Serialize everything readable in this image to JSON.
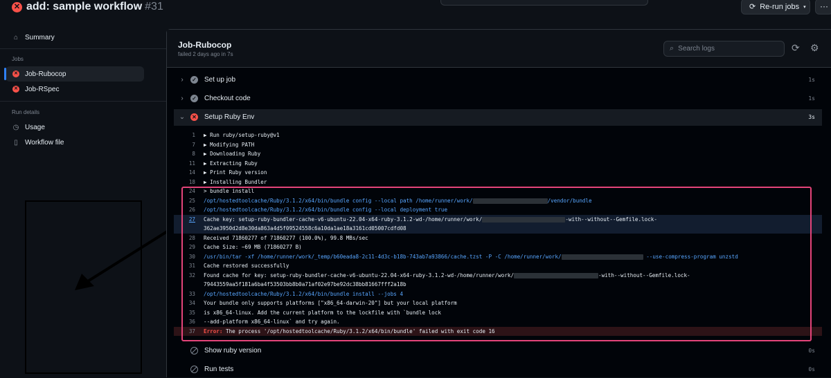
{
  "header": {
    "run_title": "add: sample workflow",
    "run_number": "#31",
    "rerun_label": "Re-run jobs",
    "more_label": "···"
  },
  "sidebar": {
    "summary_label": "Summary",
    "jobs_heading": "Jobs",
    "jobs": [
      {
        "label": "Job-Rubocop",
        "status": "failed",
        "active": true
      },
      {
        "label": "Job-RSpec",
        "status": "failed",
        "active": false
      }
    ],
    "run_details_heading": "Run details",
    "details": [
      {
        "label": "Usage",
        "icon": "stopwatch-icon"
      },
      {
        "label": "Workflow file",
        "icon": "file-icon"
      }
    ]
  },
  "job": {
    "title": "Job-Rubocop",
    "subtitle": "failed 2 days ago in 7s",
    "search_placeholder": "Search logs"
  },
  "steps_before": [
    {
      "name": "Set up job",
      "time": "1s",
      "status": "success"
    },
    {
      "name": "Checkout code",
      "time": "1s",
      "status": "success"
    }
  ],
  "open_step": {
    "name": "Setup Ruby Env",
    "time": "3s",
    "status": "failed"
  },
  "log_lines": [
    {
      "n": "1",
      "text": "▶ Run ruby/setup-ruby@v1",
      "kind": "normal"
    },
    {
      "n": "7",
      "text": "▶ Modifying PATH",
      "kind": "normal"
    },
    {
      "n": "8",
      "text": "▶ Downloading Ruby",
      "kind": "normal"
    },
    {
      "n": "11",
      "text": "▶ Extracting  Ruby",
      "kind": "normal"
    },
    {
      "n": "14",
      "text": "▶ Print Ruby version",
      "kind": "normal"
    },
    {
      "n": "18",
      "text": "▶ Installing Bundler",
      "kind": "normal"
    },
    {
      "n": "24",
      "text": "> bundle install",
      "kind": "normal"
    },
    {
      "n": "25",
      "text": "/opt/hostedtoolcache/Ruby/3.1.2/x64/bin/bundle config --local path /home/runner/work/",
      "after": "/vendor/bundle",
      "redact": 108,
      "kind": "cmd"
    },
    {
      "n": "26",
      "text": "/opt/hostedtoolcache/Ruby/3.1.2/x64/bin/bundle config --local deployment true",
      "kind": "cmd"
    },
    {
      "n": "27",
      "text": "Cache key: setup-ruby-bundler-cache-v6-ubuntu-22.04-x64-ruby-3.1.2-wd-/home/runner/work/",
      "after": "-with--without--Gemfile.lock-",
      "redact": 120,
      "kind": "sel"
    },
    {
      "n": "",
      "text": "362ae3950d2d8e30da863a4d5f09524558c6a10da1ae18a3161cd05007cdfd08",
      "kind": "sel"
    },
    {
      "n": "28",
      "text": "Received 71860277 of 71860277 (100.0%), 99.8 MBs/sec",
      "kind": "normal"
    },
    {
      "n": "29",
      "text": "Cache Size: ~69 MB (71860277 B)",
      "kind": "normal"
    },
    {
      "n": "30",
      "text": "/usr/bin/tar -xf /home/runner/work/_temp/b60eada8-2c11-4d3c-b18b-743ab7a93866/cache.tzst -P -C /home/runner/work/",
      "after": " --use-compress-program unzstd",
      "redact": 118,
      "kind": "cmd"
    },
    {
      "n": "31",
      "text": "Cache restored successfully",
      "kind": "normal"
    },
    {
      "n": "32",
      "text": "Found cache for key: setup-ruby-bundler-cache-v6-ubuntu-22.04-x64-ruby-3.1.2-wd-/home/runner/work/",
      "after": "-with--without--Gemfile.lock-",
      "redact": 122,
      "kind": "normal"
    },
    {
      "n": "",
      "text": "79443559aa5f181a6ba4f53503bb8b0a71af02e97be92dc38bb81667fff2a18b",
      "kind": "normal"
    },
    {
      "n": "33",
      "text": "/opt/hostedtoolcache/Ruby/3.1.2/x64/bin/bundle install --jobs 4",
      "kind": "cmd"
    },
    {
      "n": "34",
      "text": "Your bundle only supports platforms [\"x86_64-darwin-20\"] but your local platform",
      "kind": "normal"
    },
    {
      "n": "35",
      "text": "is x86_64-linux. Add the current platform to the lockfile with `bundle lock",
      "kind": "normal"
    },
    {
      "n": "36",
      "text": "--add-platform x86_64-linux` and try again.",
      "kind": "normal"
    },
    {
      "n": "37",
      "label": "Error:",
      "text": " The process '/opt/hostedtoolcache/Ruby/3.1.2/x64/bin/bundle' failed with exit code 16",
      "kind": "err"
    }
  ],
  "steps_after": [
    {
      "name": "Show ruby version",
      "time": "0s",
      "status": "skipped"
    },
    {
      "name": "Run tests",
      "time": "0s",
      "status": "skipped"
    }
  ],
  "colors": {
    "background": "#0d1117",
    "error": "#f85149",
    "link": "#58a6ff",
    "annotation": "#e5447a"
  }
}
